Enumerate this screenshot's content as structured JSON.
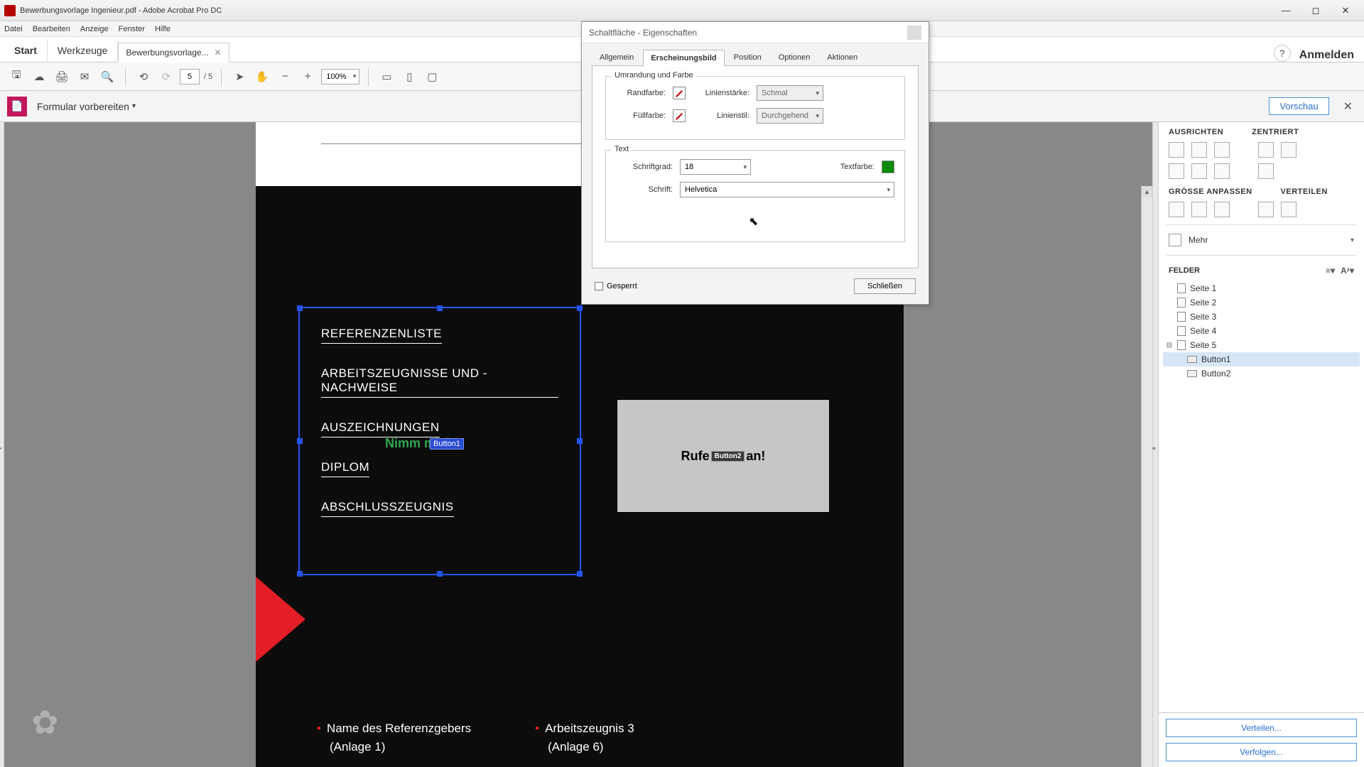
{
  "titlebar": {
    "title": "Bewerbungsvorlage Ingenieur.pdf - Adobe Acrobat Pro DC"
  },
  "menu": {
    "datei": "Datei",
    "bearbeiten": "Bearbeiten",
    "anzeige": "Anzeige",
    "fenster": "Fenster",
    "hilfe": "Hilfe"
  },
  "maintabs": {
    "start": "Start",
    "tools": "Werkzeuge",
    "doc": "Bewerbungsvorlage...",
    "signin": "Anmelden"
  },
  "toolbar": {
    "page": "5",
    "total": "/  5",
    "zoom": "100%"
  },
  "formbar": {
    "title": "Formular vorbereiten",
    "preview": "Vorschau"
  },
  "doc": {
    "rows": [
      "REFERENZENLISTE",
      "ARBEITSZEUGNISSE UND -NACHWEISE",
      "AUSZEICHNUNGEN",
      "DIPLOM",
      "ABSCHLUSSZEUGNIS"
    ],
    "green": "Nimm mich!",
    "tag1": "Button1",
    "btn2_pre": "Rufe",
    "btn2_tag": "Button2",
    "btn2_post": " an!",
    "ref1a": "Name des Referenzgebers",
    "ref1b": "(Anlage 1)",
    "ref2a": "Arbeitszeugnis 3",
    "ref2b": "(Anlage 6)"
  },
  "dialog": {
    "title": "Schaltfläche - Eigenschaften",
    "tabs": {
      "allgemein": "Allgemein",
      "erscheinung": "Erscheinungsbild",
      "position": "Position",
      "optionen": "Optionen",
      "aktionen": "Aktionen"
    },
    "fs1": "Umrandung und Farbe",
    "randfarbe": "Randfarbe:",
    "linienstaerke": "Linienstärke:",
    "linienstaerke_val": "Schmal",
    "fuellfarbe": "Füllfarbe:",
    "linienstil": "Linienstil:",
    "linienstil_val": "Durchgehend",
    "fs2": "Text",
    "schriftgrad": "Schriftgrad:",
    "schriftgrad_val": "18",
    "textfarbe": "Textfarbe:",
    "schrift": "Schrift:",
    "schrift_val": "Helvetica",
    "gesperrt": "Gesperrt",
    "close": "Schließen"
  },
  "right": {
    "ausrichten": "AUSRICHTEN",
    "zentriert": "ZENTRIERT",
    "groesse": "GRÖSSE ANPASSEN",
    "verteilen": "VERTEILEN",
    "mehr": "Mehr",
    "felder": "FELDER",
    "pages": [
      "Seite 1",
      "Seite 2",
      "Seite 3",
      "Seite 4",
      "Seite 5"
    ],
    "buttons": [
      "Button1",
      "Button2"
    ],
    "verteilen_btn": "Verteilen...",
    "verfolgen_btn": "Verfolgen..."
  }
}
